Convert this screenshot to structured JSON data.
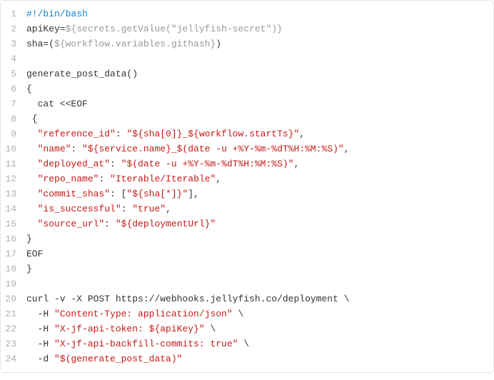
{
  "code": {
    "lines": [
      {
        "n": "1",
        "segs": [
          {
            "t": "#!/bin/bash",
            "c": "c-comment"
          }
        ]
      },
      {
        "n": "2",
        "segs": [
          {
            "t": "apiKey=",
            "c": "c-plain"
          },
          {
            "t": "${secrets.getValue(\"jellyfish-secret\")}",
            "c": "c-varexp"
          }
        ]
      },
      {
        "n": "3",
        "segs": [
          {
            "t": "sha=(",
            "c": "c-plain"
          },
          {
            "t": "${workflow.variables.githash}",
            "c": "c-varexp"
          },
          {
            "t": ")",
            "c": "c-plain"
          }
        ]
      },
      {
        "n": "4",
        "segs": [
          {
            "t": "",
            "c": "c-plain"
          }
        ]
      },
      {
        "n": "5",
        "segs": [
          {
            "t": "generate_post_data()",
            "c": "c-plain"
          }
        ]
      },
      {
        "n": "6",
        "segs": [
          {
            "t": "{",
            "c": "c-plain"
          }
        ]
      },
      {
        "n": "7",
        "segs": [
          {
            "t": "  cat <<EOF",
            "c": "c-plain"
          }
        ]
      },
      {
        "n": "8",
        "segs": [
          {
            "t": " {",
            "c": "c-plain"
          }
        ]
      },
      {
        "n": "9",
        "segs": [
          {
            "t": "  ",
            "c": "c-plain"
          },
          {
            "t": "\"reference_id\"",
            "c": "c-key"
          },
          {
            "t": ": ",
            "c": "c-plain"
          },
          {
            "t": "\"${sha[0]}_${workflow.startTs}\"",
            "c": "c-str"
          },
          {
            "t": ",",
            "c": "c-plain"
          }
        ]
      },
      {
        "n": "10",
        "segs": [
          {
            "t": "  ",
            "c": "c-plain"
          },
          {
            "t": "\"name\"",
            "c": "c-key"
          },
          {
            "t": ": ",
            "c": "c-plain"
          },
          {
            "t": "\"${service.name}_$(date -u +%Y-%m-%dT%H:%M:%S)\"",
            "c": "c-str"
          },
          {
            "t": ",",
            "c": "c-plain"
          }
        ]
      },
      {
        "n": "11",
        "segs": [
          {
            "t": "  ",
            "c": "c-plain"
          },
          {
            "t": "\"deployed_at\"",
            "c": "c-key"
          },
          {
            "t": ": ",
            "c": "c-plain"
          },
          {
            "t": "\"$(date -u +%Y-%m-%dT%H:%M:%S)\"",
            "c": "c-str"
          },
          {
            "t": ",",
            "c": "c-plain"
          }
        ]
      },
      {
        "n": "12",
        "segs": [
          {
            "t": "  ",
            "c": "c-plain"
          },
          {
            "t": "\"repo_name\"",
            "c": "c-key"
          },
          {
            "t": ": ",
            "c": "c-plain"
          },
          {
            "t": "\"Iterable/Iterable\"",
            "c": "c-str"
          },
          {
            "t": ",",
            "c": "c-plain"
          }
        ]
      },
      {
        "n": "13",
        "segs": [
          {
            "t": "  ",
            "c": "c-plain"
          },
          {
            "t": "\"commit_shas\"",
            "c": "c-key"
          },
          {
            "t": ": [",
            "c": "c-plain"
          },
          {
            "t": "\"${sha[*]}\"",
            "c": "c-str"
          },
          {
            "t": "],",
            "c": "c-plain"
          }
        ]
      },
      {
        "n": "14",
        "segs": [
          {
            "t": "  ",
            "c": "c-plain"
          },
          {
            "t": "\"is_successful\"",
            "c": "c-key"
          },
          {
            "t": ": ",
            "c": "c-plain"
          },
          {
            "t": "\"true\"",
            "c": "c-str"
          },
          {
            "t": ",",
            "c": "c-plain"
          }
        ]
      },
      {
        "n": "15",
        "segs": [
          {
            "t": "  ",
            "c": "c-plain"
          },
          {
            "t": "\"source_url\"",
            "c": "c-key"
          },
          {
            "t": ": ",
            "c": "c-plain"
          },
          {
            "t": "\"${deploymentUrl}\"",
            "c": "c-str"
          }
        ]
      },
      {
        "n": "16",
        "segs": [
          {
            "t": "}",
            "c": "c-plain"
          }
        ]
      },
      {
        "n": "17",
        "segs": [
          {
            "t": "EOF",
            "c": "c-plain"
          }
        ]
      },
      {
        "n": "18",
        "segs": [
          {
            "t": "}",
            "c": "c-plain"
          }
        ]
      },
      {
        "n": "19",
        "segs": [
          {
            "t": "",
            "c": "c-plain"
          }
        ]
      },
      {
        "n": "20",
        "segs": [
          {
            "t": "curl -v -X POST https://webhooks.jellyfish.co/deployment \\",
            "c": "c-plain"
          }
        ]
      },
      {
        "n": "21",
        "segs": [
          {
            "t": "  -H ",
            "c": "c-plain"
          },
          {
            "t": "\"Content-Type: application/json\"",
            "c": "c-str"
          },
          {
            "t": " \\",
            "c": "c-plain"
          }
        ]
      },
      {
        "n": "22",
        "segs": [
          {
            "t": "  -H ",
            "c": "c-plain"
          },
          {
            "t": "\"X-jf-api-token: ${apiKey}\"",
            "c": "c-str"
          },
          {
            "t": " \\",
            "c": "c-plain"
          }
        ]
      },
      {
        "n": "23",
        "segs": [
          {
            "t": "  -H ",
            "c": "c-plain"
          },
          {
            "t": "\"X-jf-api-backfill-commits: true\"",
            "c": "c-str"
          },
          {
            "t": " \\",
            "c": "c-plain"
          }
        ]
      },
      {
        "n": "24",
        "segs": [
          {
            "t": "  -d ",
            "c": "c-plain"
          },
          {
            "t": "\"$(generate_post_data)\"",
            "c": "c-str"
          }
        ]
      }
    ]
  }
}
